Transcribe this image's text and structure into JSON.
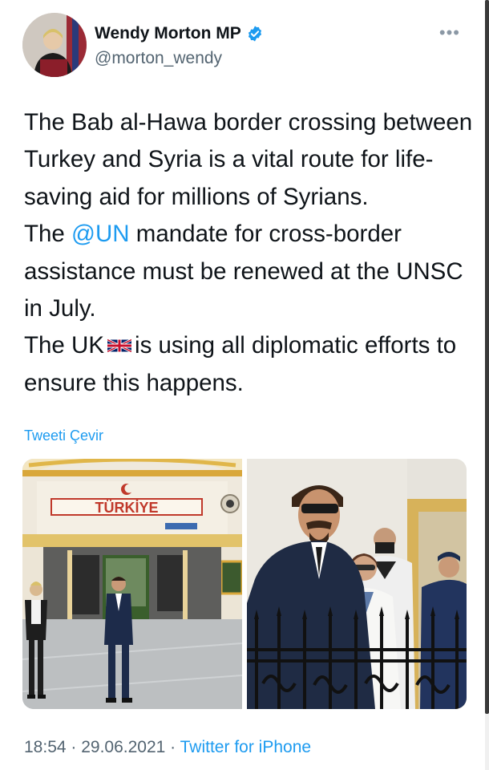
{
  "author": {
    "name": "Wendy Morton MP",
    "handle": "@morton_wendy",
    "verified": true
  },
  "more_icon": "more-horizontal-icon",
  "tweet": {
    "line1": "The Bab al-Hawa border crossing between Turkey and Syria is a vital route for life-saving aid for millions of Syrians.",
    "line2_before": "The ",
    "mention": "@UN",
    "line2_after": " mandate for cross-border assistance must be renewed at the UNSC in July.",
    "line3_before": "The UK",
    "line3_after": "is using all diplomatic efforts to ensure this happens."
  },
  "translate_label": "Tweeti Çevir",
  "photo_left": {
    "sign_text": "TÜRKİYE"
  },
  "meta": {
    "time": "18:54",
    "date": "29.06.2021",
    "separator": " · ",
    "source": "Twitter for iPhone"
  },
  "colors": {
    "link": "#1d9bf0",
    "secondary_text": "#536471",
    "primary_text": "#0f1419"
  }
}
